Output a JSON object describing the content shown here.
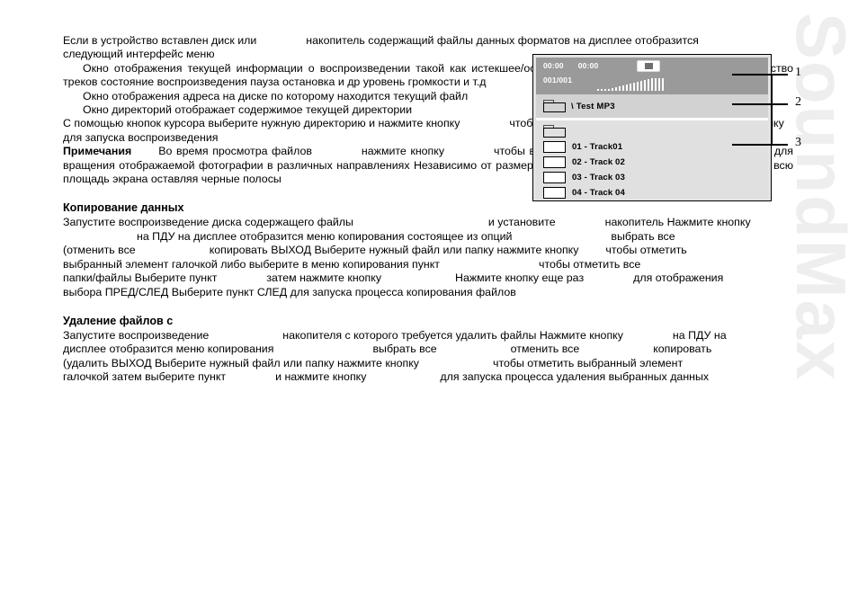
{
  "watermark": {
    "text": "SoundMax"
  },
  "intro": {
    "line1_a": "Если в устройство вставлен диск или",
    "line1_b": "накопитель  содержащий файлы данных форматов  на дисплее отобразится",
    "line1_c": "следующий интерфейс меню",
    "p2_a": "Окно отображения текущей информации о воспроизведении  такой как истекшее/оставшееся  время  трека   номер  трека   количество  треков   состояние воспроизведения  пауза  остановка и др   уровень громкости и т.д",
    "p3_a": "Окно  отображения  адреса  на  диске   по  которому  находится  текущий файл",
    "p4_a": "Окно директорий   отображает содержимое текущей директории",
    "p5_a": "С  помощью  кнопок  курсора  выберите  нужную  директорию  и  нажмите кнопку",
    "p5_b": "чтобы войти в нее  Выберите файл и нажмите кнопку",
    "p5_c": "для запуска воспроизведения",
    "notes_label": "Примечания",
    "notes_a": "Во время просмотра файлов",
    "notes_b": "нажмите кнопку",
    "notes_c": "чтобы вернуться к меню  Нажимайте кнопки курсора  для  вращения  отображаемой  фотографии  в  различных  направлениях   Независимо  от  размера  и  формата  фотографии могут не занимать всю площадь экрана  оставляя черные полосы"
  },
  "display": {
    "time_elapsed": "00:00",
    "time_total": "00:00",
    "track_count": "001/001",
    "stop_icon": "stop-icon",
    "eq_bar_heights": [
      2,
      2,
      2,
      2,
      3,
      4,
      5,
      6,
      7,
      8,
      9,
      10,
      11,
      12,
      13,
      14,
      14,
      14,
      14
    ],
    "current_path": "\\ Test MP3",
    "path_icon": "folder-icon",
    "rows": [
      {
        "icon": "folder-icon",
        "label": ""
      },
      {
        "icon": "file-icon",
        "label": "01 - Track01"
      },
      {
        "icon": "file-icon",
        "label": "02 - Track 02"
      },
      {
        "icon": "file-icon",
        "label": "03 - Track 03"
      },
      {
        "icon": "file-icon",
        "label": "04 - Track 04"
      }
    ]
  },
  "callouts": {
    "n1": "1",
    "n2": "2",
    "n3": "3"
  },
  "copy_section": {
    "heading": "Копирование данных",
    "l1_a": "Запустите воспроизведение диска  содержащего файлы",
    "l1_b": "и установите",
    "l1_c": "накопитель  Нажмите кнопку",
    "l2_a": "на ПДУ  на дисплее отобразится меню копирования  состоящее из опций",
    "l2_b": "выбрать все",
    "l3_a": "(отменить все",
    "l3_b": "копировать  ВЫХОД  Выберите нужный файл или папку  нажмите кнопку",
    "l3_c": "чтобы отметить",
    "l4_a": "выбранный  элемент  галочкой    либо  выберите  в  меню  копирования  пункт",
    "l4_b": "чтобы  отметить  все",
    "l5_a": "папки/файлы  Выберите пункт",
    "l5_b": "затем нажмите кнопку",
    "l5_c": "Нажмите кнопку еще раз",
    "l5_d": "для отображения",
    "l6_a": "выбора ПРЕД/СЛЕД  Выберите пункт СЛЕД для запуска процесса копирования файлов"
  },
  "delete_section": {
    "heading": "Удаление файлов с",
    "l1_a": "Запустите воспроизведение",
    "l1_b": "накопителя  с которого требуется удалить файлы  Нажмите кнопку",
    "l1_c": "на ПДУ  на",
    "l2_a": "дисплее отобразится меню копирования",
    "l2_b": "выбрать все",
    "l2_c": "отменить все",
    "l2_d": "копировать",
    "l3_a": "(удалить  ВЫХОД  Выберите нужный файл или папку  нажмите кнопку",
    "l3_b": "чтобы отметить выбранный элемент",
    "l4_a": "галочкой  затем выберите пункт",
    "l4_b": "и нажмите кнопку",
    "l4_c": "для запуска процесса удаления выбранных данных"
  }
}
